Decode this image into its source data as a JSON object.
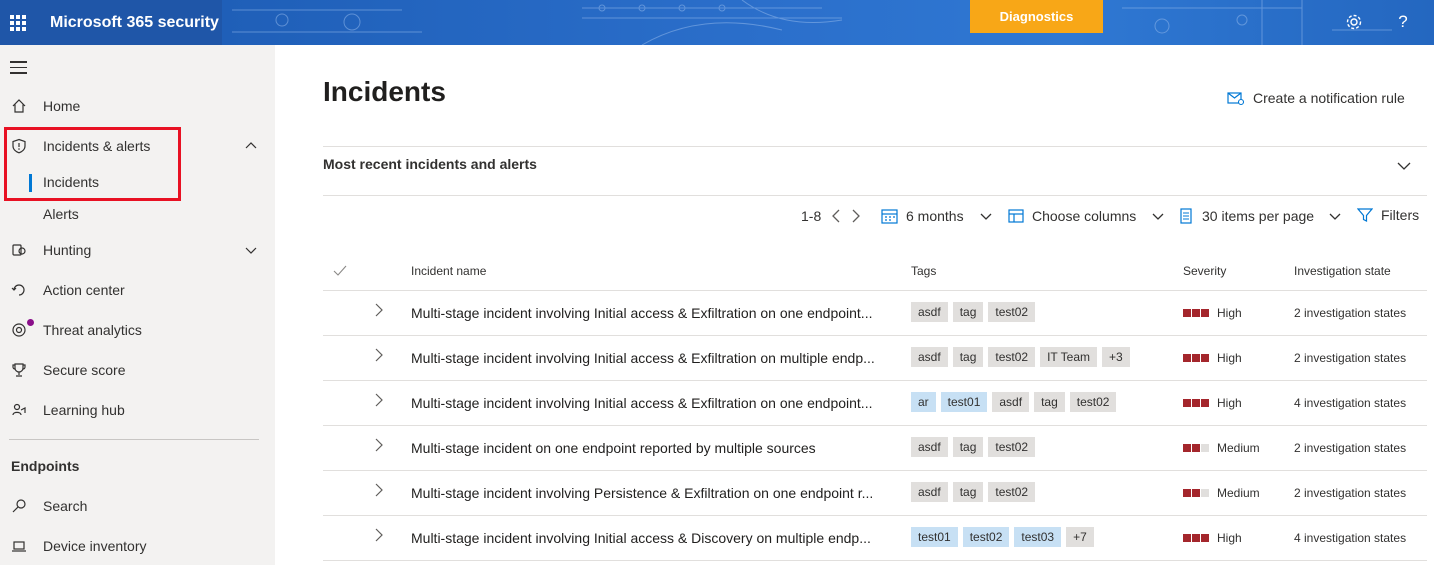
{
  "app": {
    "title": "Microsoft 365 security",
    "diagnostics_label": "Diagnostics"
  },
  "sidebar": {
    "items": [
      {
        "label": "Home"
      },
      {
        "label": "Incidents & alerts"
      },
      {
        "label": "Incidents"
      },
      {
        "label": "Alerts"
      },
      {
        "label": "Hunting"
      },
      {
        "label": "Action center"
      },
      {
        "label": "Threat analytics"
      },
      {
        "label": "Secure score"
      },
      {
        "label": "Learning hub"
      }
    ],
    "endpoints_heading": "Endpoints",
    "endpoint_items": [
      {
        "label": "Search"
      },
      {
        "label": "Device inventory"
      }
    ]
  },
  "main": {
    "title": "Incidents",
    "notification_rule": "Create a notification rule",
    "section_title": "Most recent incidents and alerts",
    "toolbar": {
      "paging": "1-8",
      "time_range": "6 months",
      "choose_columns": "Choose columns",
      "items_per_page": "30 items per page",
      "filters": "Filters"
    },
    "columns": {
      "name": "Incident name",
      "tags": "Tags",
      "severity": "Severity",
      "investigation": "Investigation state"
    },
    "rows": [
      {
        "name": "Multi-stage incident involving Initial access & Exfiltration on one endpoint...",
        "tags": [
          {
            "t": "asdf",
            "c": "gray"
          },
          {
            "t": "tag",
            "c": "gray"
          },
          {
            "t": "test02",
            "c": "gray"
          }
        ],
        "severity": "High",
        "level": 3,
        "investigation": "2 investigation states"
      },
      {
        "name": "Multi-stage incident involving Initial access & Exfiltration on multiple endp...",
        "tags": [
          {
            "t": "asdf",
            "c": "gray"
          },
          {
            "t": "tag",
            "c": "gray"
          },
          {
            "t": "test02",
            "c": "gray"
          },
          {
            "t": "IT Team",
            "c": "gray"
          },
          {
            "t": "+3",
            "c": "gray"
          }
        ],
        "severity": "High",
        "level": 3,
        "investigation": "2 investigation states"
      },
      {
        "name": "Multi-stage incident involving Initial access & Exfiltration on one endpoint...",
        "tags": [
          {
            "t": "ar",
            "c": "blue"
          },
          {
            "t": "test01",
            "c": "blue"
          },
          {
            "t": "asdf",
            "c": "gray"
          },
          {
            "t": "tag",
            "c": "gray"
          },
          {
            "t": "test02",
            "c": "gray"
          }
        ],
        "severity": "High",
        "level": 3,
        "investigation": "4 investigation states"
      },
      {
        "name": "Multi-stage incident on one endpoint reported by multiple sources",
        "tags": [
          {
            "t": "asdf",
            "c": "gray"
          },
          {
            "t": "tag",
            "c": "gray"
          },
          {
            "t": "test02",
            "c": "gray"
          }
        ],
        "severity": "Medium",
        "level": 2,
        "investigation": "2 investigation states"
      },
      {
        "name": "Multi-stage incident involving Persistence & Exfiltration on one endpoint r...",
        "tags": [
          {
            "t": "asdf",
            "c": "gray"
          },
          {
            "t": "tag",
            "c": "gray"
          },
          {
            "t": "test02",
            "c": "gray"
          }
        ],
        "severity": "Medium",
        "level": 2,
        "investigation": "2 investigation states"
      },
      {
        "name": "Multi-stage incident involving Initial access & Discovery on multiple endp...",
        "tags": [
          {
            "t": "test01",
            "c": "blue"
          },
          {
            "t": "test02",
            "c": "blue"
          },
          {
            "t": "test03",
            "c": "blue"
          },
          {
            "t": "+7",
            "c": "gray"
          }
        ],
        "severity": "High",
        "level": 3,
        "investigation": "4 investigation states"
      }
    ]
  },
  "colors": {
    "brand": "#1f56a8",
    "diagnostics": "#f8a717",
    "accent": "#0078d4",
    "severity": "#a4262c",
    "highlight_box": "#e81123"
  }
}
